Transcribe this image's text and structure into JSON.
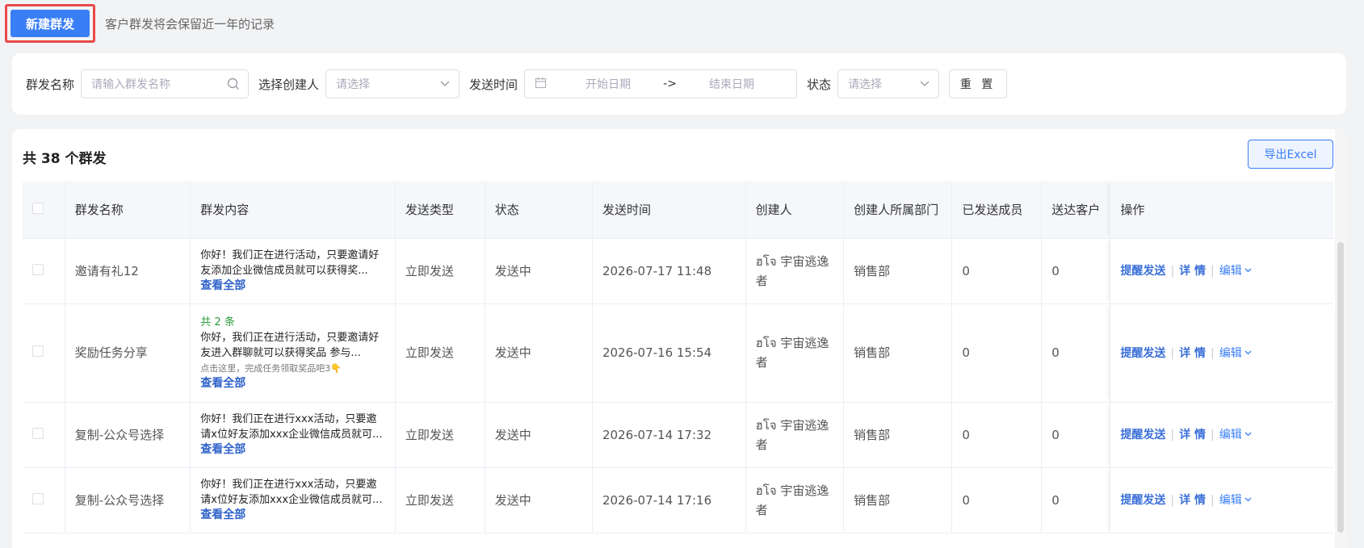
{
  "topbar": {
    "new_button": "新建群发",
    "hint": "客户群发将会保留近一年的记录"
  },
  "filters": {
    "name_label": "群发名称",
    "name_placeholder": "请输入群发名称",
    "creator_label": "选择创建人",
    "creator_placeholder": "请选择",
    "time_label": "发送时间",
    "start_placeholder": "开始日期",
    "range_sep": "->",
    "end_placeholder": "结束日期",
    "status_label": "状态",
    "status_placeholder": "请选择",
    "reset": "重 置"
  },
  "list": {
    "title": "共 38 个群发",
    "export": "导出Excel",
    "headers": [
      "群发名称",
      "群发内容",
      "发送类型",
      "状态",
      "发送时间",
      "创建人",
      "创建人所属部门",
      "已发送成员",
      "送达客户",
      "操作"
    ],
    "view_all": "查看全部",
    "ops": {
      "remind": "提醒发送",
      "detail": "详 情",
      "edit": "编辑"
    },
    "rows": [
      {
        "name": "邀请有礼12",
        "count": "",
        "content": "你好！我们正在进行活动，只要邀请好友添加企业微信成员就可以获得奖...",
        "sub": "",
        "type": "立即发送",
        "status": "发送中",
        "time": "2026-07-17 11:48",
        "creator": "ฮโจ 宇宙逃逸者",
        "dept": "销售部",
        "sent": "0",
        "reached": "0"
      },
      {
        "name": "奖励任务分享",
        "count": "共 2 条",
        "content": "你好，我们正在进行活动，只要邀请好友进入群聊就可以获得奖品 参与...",
        "sub": "点击这里，完成任务领取奖品吧3👇",
        "type": "立即发送",
        "status": "发送中",
        "time": "2026-07-16 15:54",
        "creator": "ฮโจ 宇宙逃逸者",
        "dept": "销售部",
        "sent": "0",
        "reached": "0"
      },
      {
        "name": "复制-公众号选择",
        "count": "",
        "content": "你好！我们正在进行xxx活动，只要邀请x位好友添加xxx企业微信成员就可...",
        "sub": "",
        "type": "立即发送",
        "status": "发送中",
        "time": "2026-07-14 17:32",
        "creator": "ฮโจ 宇宙逃逸者",
        "dept": "销售部",
        "sent": "0",
        "reached": "0"
      },
      {
        "name": "复制-公众号选择",
        "count": "",
        "content": "你好！我们正在进行xxx活动，只要邀请x位好友添加xxx企业微信成员就可...",
        "sub": "",
        "type": "立即发送",
        "status": "发送中",
        "time": "2026-07-14 17:16",
        "creator": "ฮโจ 宇宙逃逸者",
        "dept": "销售部",
        "sent": "0",
        "reached": "0"
      }
    ]
  }
}
